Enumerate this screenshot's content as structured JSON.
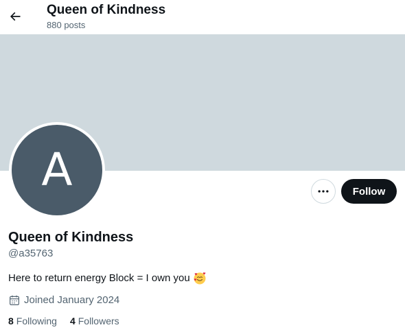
{
  "header": {
    "title": "Queen of Kindness",
    "posts_count": "880",
    "posts_label": "posts"
  },
  "icons": {
    "back": "arrow-left-icon",
    "more": "ellipsis-icon",
    "calendar": "calendar-icon",
    "bio_emoji": "smiling-face-with-hearts-emoji"
  },
  "avatar": {
    "initial": "A",
    "color": "#4a5b69"
  },
  "banner": {
    "color": "#cfd9de"
  },
  "actions": {
    "follow_label": "Follow"
  },
  "profile": {
    "display_name": "Queen of Kindness",
    "handle": "@a35763",
    "bio": "Here to return energy Block = I own you",
    "joined": "Joined January 2024",
    "following_count": "8",
    "following_label": "Following",
    "followers_count": "4",
    "followers_label": "Followers"
  }
}
